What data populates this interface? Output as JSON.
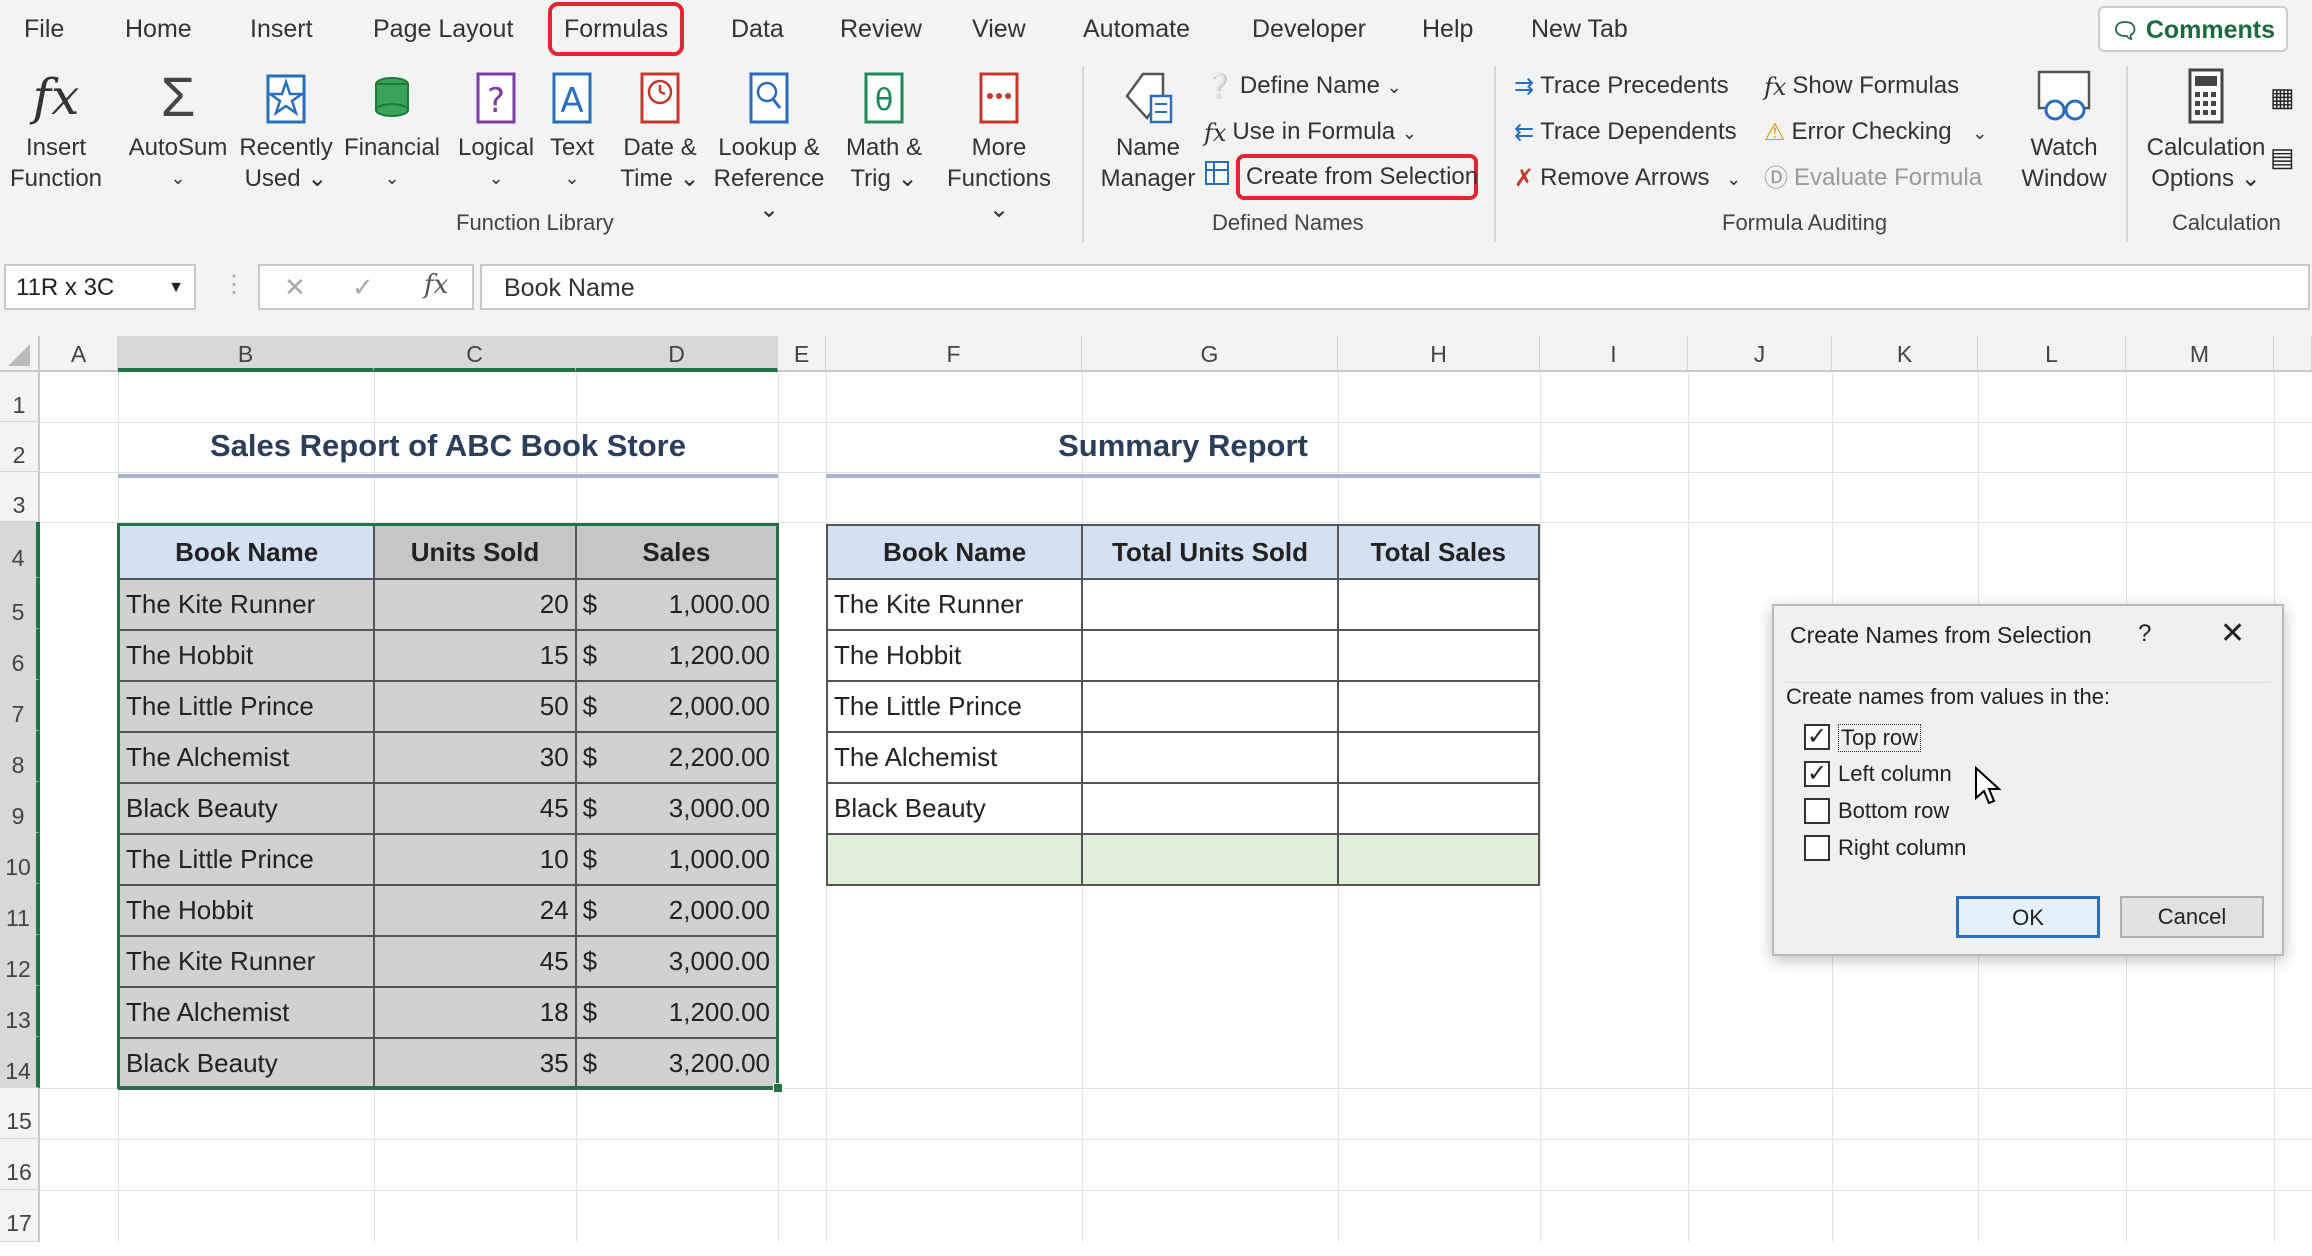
{
  "tabs": [
    "File",
    "Home",
    "Insert",
    "Page Layout",
    "Formulas",
    "Data",
    "Review",
    "View",
    "Automate",
    "Developer",
    "Help",
    "New Tab"
  ],
  "comments_label": "Comments",
  "ribbon": {
    "insert_function": [
      "Insert",
      "Function"
    ],
    "autosum": "AutoSum",
    "recently_used": [
      "Recently",
      "Used"
    ],
    "financial": "Financial",
    "logical": "Logical",
    "text": "Text",
    "date_time": [
      "Date &",
      "Time"
    ],
    "lookup_reference": [
      "Lookup &",
      "Reference"
    ],
    "math_trig": [
      "Math &",
      "Trig"
    ],
    "more_functions": [
      "More",
      "Functions"
    ],
    "function_library_label": "Function Library",
    "name_manager": [
      "Name",
      "Manager"
    ],
    "define_name": "Define Name",
    "use_in_formula": "Use in Formula",
    "create_from_selection": "Create from Selection",
    "defined_names_label": "Defined Names",
    "trace_precedents": "Trace Precedents",
    "trace_dependents": "Trace Dependents",
    "remove_arrows": "Remove Arrows",
    "show_formulas": "Show Formulas",
    "error_checking": "Error Checking",
    "evaluate_formula": "Evaluate Formula",
    "formula_auditing_label": "Formula Auditing",
    "watch_window": [
      "Watch",
      "Window"
    ],
    "calculation_options": [
      "Calculation",
      "Options"
    ],
    "calculation_label": "Calculation"
  },
  "formula_bar": {
    "name_box": "11R x 3C",
    "content": "Book Name"
  },
  "columns": [
    "A",
    "B",
    "C",
    "D",
    "E",
    "F",
    "G",
    "H",
    "I",
    "J",
    "K",
    "L",
    "M"
  ],
  "rows": [
    "1",
    "2",
    "3",
    "4",
    "5",
    "6",
    "7",
    "8",
    "9",
    "10",
    "11",
    "12",
    "13",
    "14",
    "15",
    "16",
    "17"
  ],
  "sales_title": "Sales Report of ABC Book Store",
  "summary_title": "Summary Report",
  "sales_table": {
    "headers": [
      "Book Name",
      "Units Sold",
      "Sales"
    ],
    "rows": [
      [
        "The Kite Runner",
        "20",
        "$",
        "1,000.00"
      ],
      [
        "The Hobbit",
        "15",
        "$",
        "1,200.00"
      ],
      [
        "The Little Prince",
        "50",
        "$",
        "2,000.00"
      ],
      [
        "The Alchemist",
        "30",
        "$",
        "2,200.00"
      ],
      [
        "Black Beauty",
        "45",
        "$",
        "3,000.00"
      ],
      [
        "The Little Prince",
        "10",
        "$",
        "1,000.00"
      ],
      [
        "The Hobbit",
        "24",
        "$",
        "2,000.00"
      ],
      [
        "The Kite Runner",
        "45",
        "$",
        "3,000.00"
      ],
      [
        "The Alchemist",
        "18",
        "$",
        "1,200.00"
      ],
      [
        "Black Beauty",
        "35",
        "$",
        "3,200.00"
      ]
    ]
  },
  "summary_table": {
    "headers": [
      "Book Name",
      "Total Units Sold",
      "Total Sales"
    ],
    "rows": [
      "The Kite Runner",
      "The Hobbit",
      "The Little Prince",
      "The Alchemist",
      "Black Beauty"
    ]
  },
  "dialog": {
    "title": "Create Names from Selection",
    "help": "?",
    "prompt": "Create names from values in the:",
    "options": [
      {
        "label": "Top row",
        "checked": true
      },
      {
        "label": "Left column",
        "checked": true
      },
      {
        "label": "Bottom row",
        "checked": false
      },
      {
        "label": "Right column",
        "checked": false
      }
    ],
    "ok": "OK",
    "cancel": "Cancel"
  },
  "colors": {
    "accent": "#217346",
    "highlight": "#e0262f",
    "header_fill": "#d4e1f3"
  }
}
